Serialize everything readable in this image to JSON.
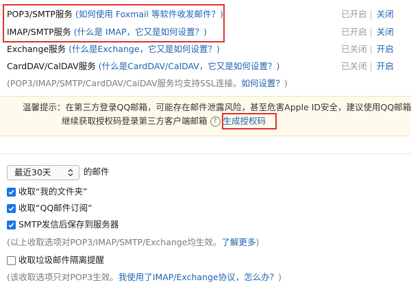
{
  "services": [
    {
      "name": "POP3/SMTP服务",
      "help": "(如何使用 Foxmail 等软件收发邮件？)",
      "status": "已开启",
      "action": "关闭"
    },
    {
      "name": "IMAP/SMTP服务",
      "help": "(什么是 IMAP，它又是如何设置？)",
      "status": "已开启",
      "action": "关闭"
    },
    {
      "name": "Exchange服务",
      "help": "(什么是Exchange，它又是如何设置？)",
      "status": "已关闭",
      "action": "开启"
    },
    {
      "name": "CardDAV/CalDAV服务",
      "help": "(什么是CardDAV/CalDAV，它又是如何设置？)",
      "status": "已关闭",
      "action": "开启"
    }
  ],
  "ssl_note": {
    "text": "(POP3/IMAP/SMTP/CardDAV/CalDAV服务均支持SSL连接。",
    "link": "如何设置？",
    "close": ")"
  },
  "tip": {
    "line1": "温馨提示：在第三方登录QQ邮箱，可能存在邮件泄露风险，甚至危害Apple ID安全，建议使用QQ邮箱手机",
    "line2": "继续获取授权码登录第三方客户端邮箱",
    "help_glyph": "?",
    "link": "生成授权码"
  },
  "receive": {
    "select_value": "最近30天",
    "suffix": "的邮件"
  },
  "options": [
    {
      "label": "收取“我的文件夹”",
      "checked": true
    },
    {
      "label": "收取“QQ邮件订阅”",
      "checked": true
    },
    {
      "label": "SMTP发信后保存到服务器",
      "checked": true
    }
  ],
  "options_note": {
    "text": "(以上收取选项对POP3/IMAP/SMTP/Exchange均生效。",
    "link": "了解更多",
    "close": ")"
  },
  "spam": {
    "label": "收取垃圾邮件隔离提醒",
    "checked": false
  },
  "spam_note": {
    "text": "(该收取选项只对POP3生效。",
    "link": "我使用了IMAP/Exchange协议，怎么办？",
    "close": ")"
  },
  "accent_color": "#1d63b3",
  "highlight_color": "#e02d2d"
}
